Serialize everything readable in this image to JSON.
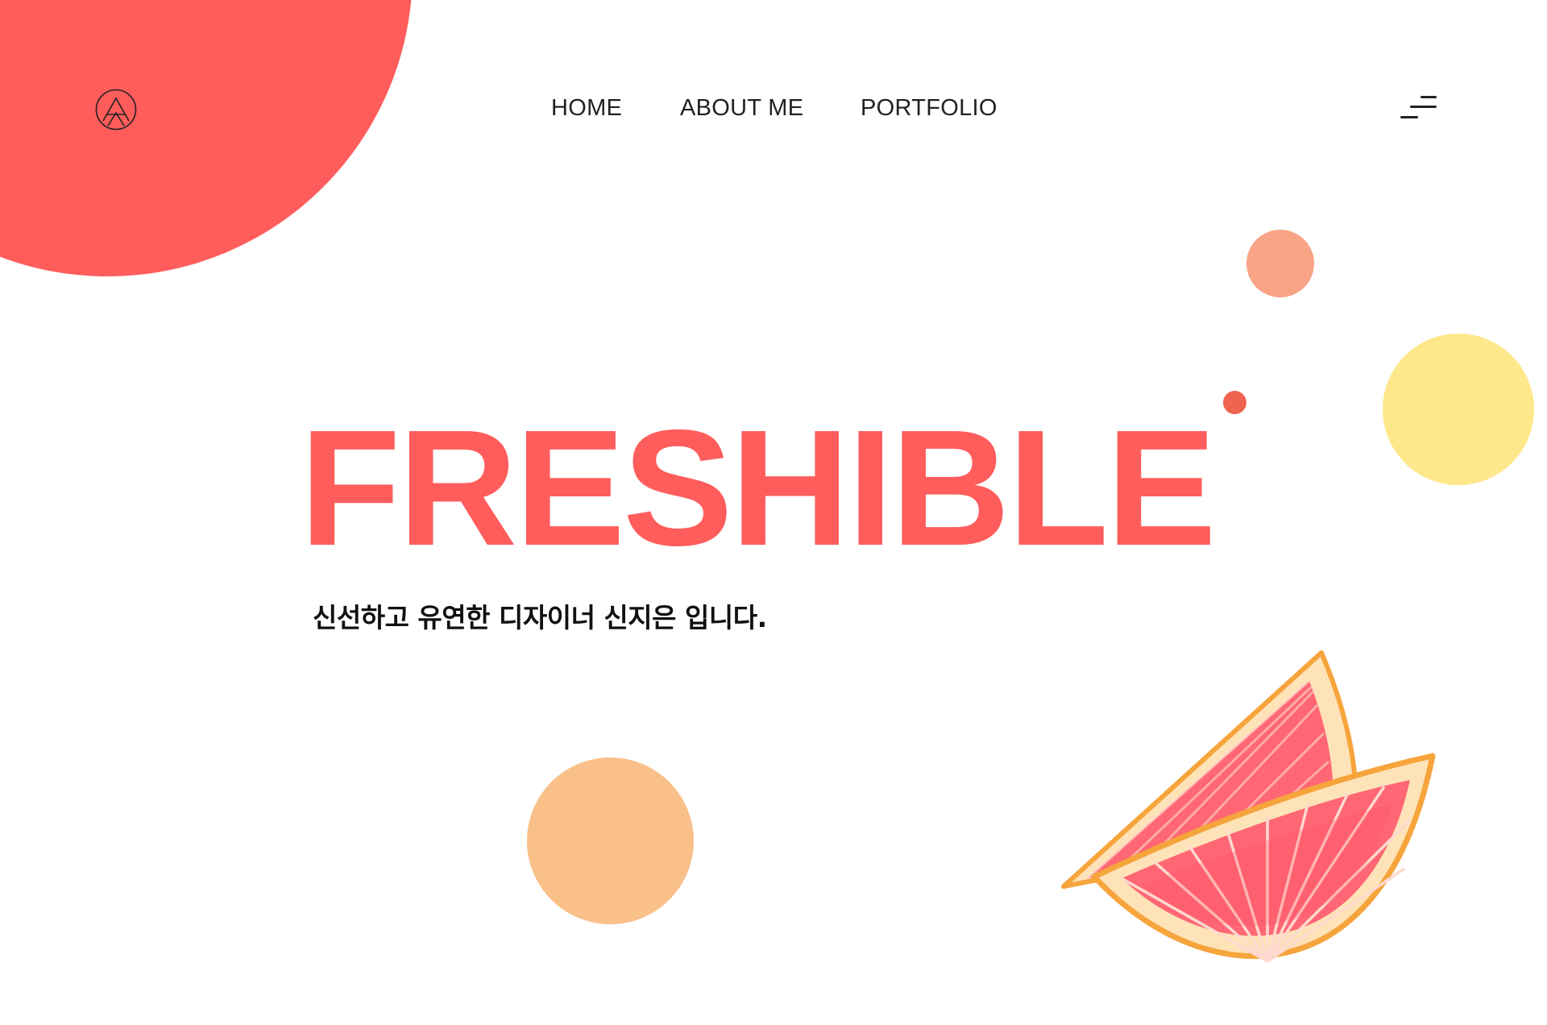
{
  "brand": {
    "logo_icon": "mountain-circle-logo-icon"
  },
  "nav": {
    "items": [
      {
        "label": "HOME"
      },
      {
        "label": "ABOUT ME"
      },
      {
        "label": "PORTFOLIO"
      }
    ],
    "menu_icon": "hamburger-menu-icon"
  },
  "hero": {
    "title": "FRESHIBLE",
    "subtitle": "신선하고 유연한 디자이너 신지은 입니다."
  },
  "decor": {
    "grapefruit_icon": "grapefruit-slices-illustration"
  },
  "colors": {
    "accent": "#ff5c5c",
    "salmon": "#f9a486",
    "yellow": "#ffe78c",
    "peach": "#f9c089",
    "text": "#222222"
  }
}
